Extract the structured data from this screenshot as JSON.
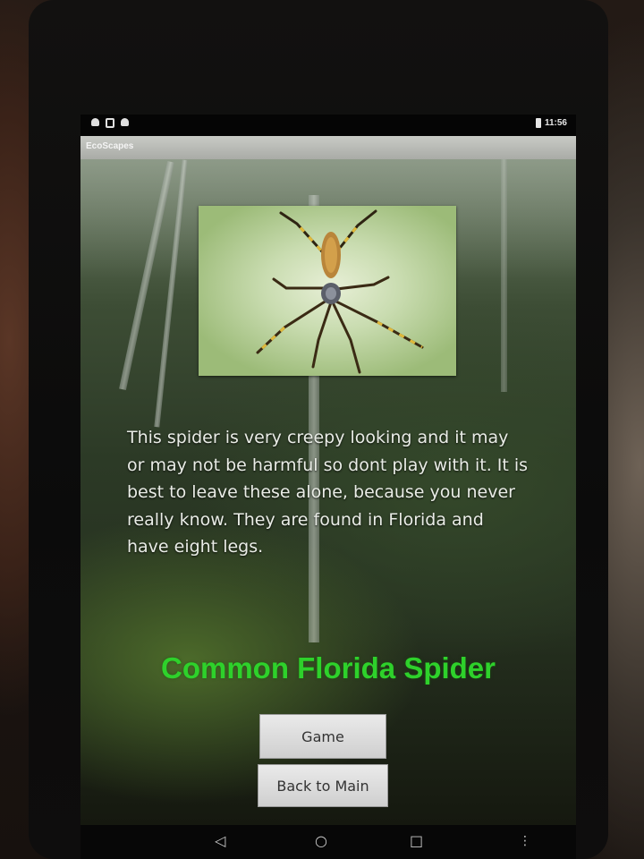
{
  "status_bar": {
    "time": "11:56",
    "notification_icons": [
      "notification-icon",
      "notification-icon",
      "notification-icon"
    ],
    "battery_icon": "battery-icon"
  },
  "app_bar": {
    "title": "EcoScapes"
  },
  "content": {
    "description": "This spider is very creepy looking and it may or may not be harmful so dont play with it. It is best to leave these alone, because you never really know. They are found in Florida and have eight legs.",
    "common_name": "Common Florida Spider",
    "accent_color": "#2ed12b"
  },
  "buttons": {
    "game_label": "Game",
    "back_label": "Back to Main"
  },
  "nav_bar": {
    "back_glyph": "◁",
    "home_glyph": "○",
    "recents_glyph": "□",
    "menu_glyph": "⋮"
  }
}
